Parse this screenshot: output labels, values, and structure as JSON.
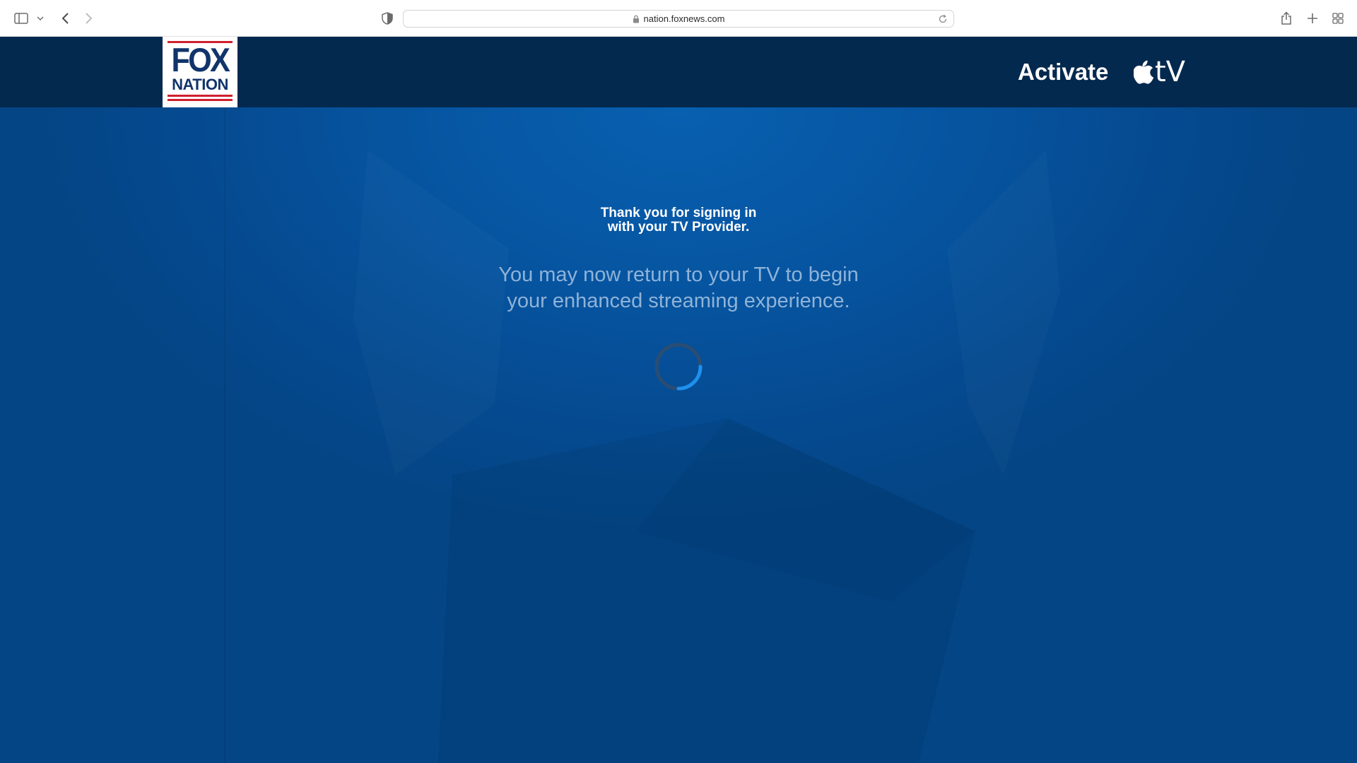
{
  "browser": {
    "url": "nation.foxnews.com",
    "icons": [
      "sidebar-icon",
      "chevron-down-icon",
      "back-icon",
      "forward-icon",
      "shield-icon",
      "lock-icon",
      "reload-icon",
      "share-icon",
      "plus-icon",
      "tab-overview-icon"
    ]
  },
  "header": {
    "logo": {
      "line1": "FOX",
      "line2": "NATION"
    },
    "title": "Activate",
    "platform_logo_text": "tV",
    "colors": {
      "bar": "#04294e",
      "logo_blue": "#11346b",
      "logo_red": "#d0202e"
    }
  },
  "main": {
    "thanks_line1": "Thank you for signing in",
    "thanks_line2": "with your TV Provider.",
    "message_line1": "You may now return to your TV to begin",
    "message_line2": "your enhanced streaming experience.",
    "colors": {
      "background": "#0654a0",
      "message": "#8fb3d8",
      "spinner_accent": "#1e90f0"
    }
  }
}
